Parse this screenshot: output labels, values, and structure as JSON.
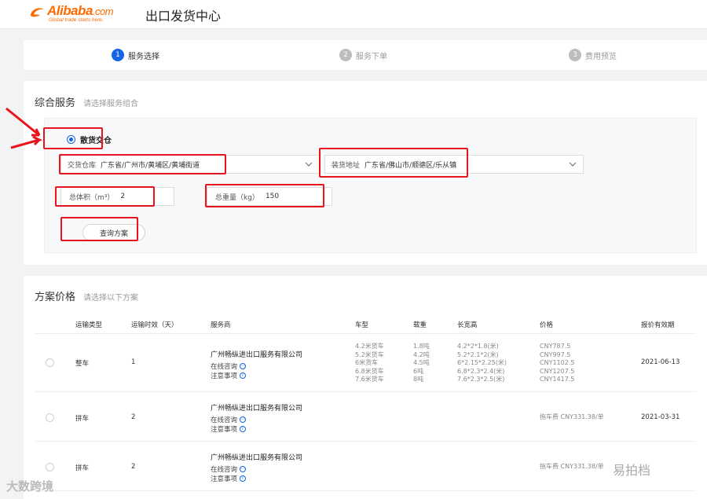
{
  "header": {
    "logo_text": "Alibaba",
    "logo_com": ".com",
    "logo_sub": "Global trade starts here.",
    "title": "出口发货中心"
  },
  "steps": [
    {
      "num": "1",
      "label": "服务选择",
      "active": true
    },
    {
      "num": "2",
      "label": "服务下单",
      "active": false
    },
    {
      "num": "3",
      "label": "费用预览",
      "active": false
    }
  ],
  "service": {
    "title": "综合服务",
    "hint": "请选择服务组合",
    "option_label": "散货交仓",
    "warehouse_label": "交货仓库",
    "warehouse_value": "广东省/广州市/黄埔区/黄埔街道",
    "pickup_label": "装货地址",
    "pickup_value": "广东省/佛山市/顺德区/乐从镇",
    "volume_label": "总体积（m³）",
    "volume_value": "2",
    "weight_label": "总重量（kg）",
    "weight_value": "150",
    "query_button": "查询方案"
  },
  "plans": {
    "title": "方案价格",
    "hint": "请选择以下方案",
    "columns": [
      "运输类型",
      "运输时效（天）",
      "服务商",
      "车型",
      "载重",
      "长宽高",
      "价格",
      "报价有效期"
    ],
    "rows": [
      {
        "type": "整车",
        "days": "1",
        "provider": "广州畅纵进出口服务有限公司",
        "consult": "在线咨询",
        "notes": "注意事项",
        "vehicles": [
          "4.2米货车",
          "5.2米货车",
          "6米货车",
          "6.8米货车",
          "7.6米货车"
        ],
        "loads": [
          "1.8吨",
          "4.2吨",
          "4.5吨",
          "6吨",
          "8吨"
        ],
        "dims": [
          "4.2*2*1.8(米)",
          "5.2*2.1*2(米)",
          "6*2.15*2.25(米)",
          "6.8*2.3*2.4(米)",
          "7.6*2.3*2.5(米)"
        ],
        "prices": [
          "CNY787.5",
          "CNY997.5",
          "CNY1102.5",
          "CNY1207.5",
          "CNY1417.5"
        ],
        "valid": "2021-06-13"
      },
      {
        "type": "拼车",
        "days": "2",
        "provider": "广州畅纵进出口服务有限公司",
        "consult": "在线咨询",
        "notes": "注意事项",
        "price": "拖车费 CNY331.38/单",
        "valid": "2021-03-31"
      },
      {
        "type": "拼车",
        "days": "2",
        "provider": "广州畅纵进出口服务有限公司",
        "consult": "在线咨询",
        "notes": "注意事项",
        "price": "拖车费 CNY331.38/单",
        "valid": ""
      }
    ]
  },
  "watermarks": {
    "left": "大数跨境",
    "right": "易拍档"
  }
}
